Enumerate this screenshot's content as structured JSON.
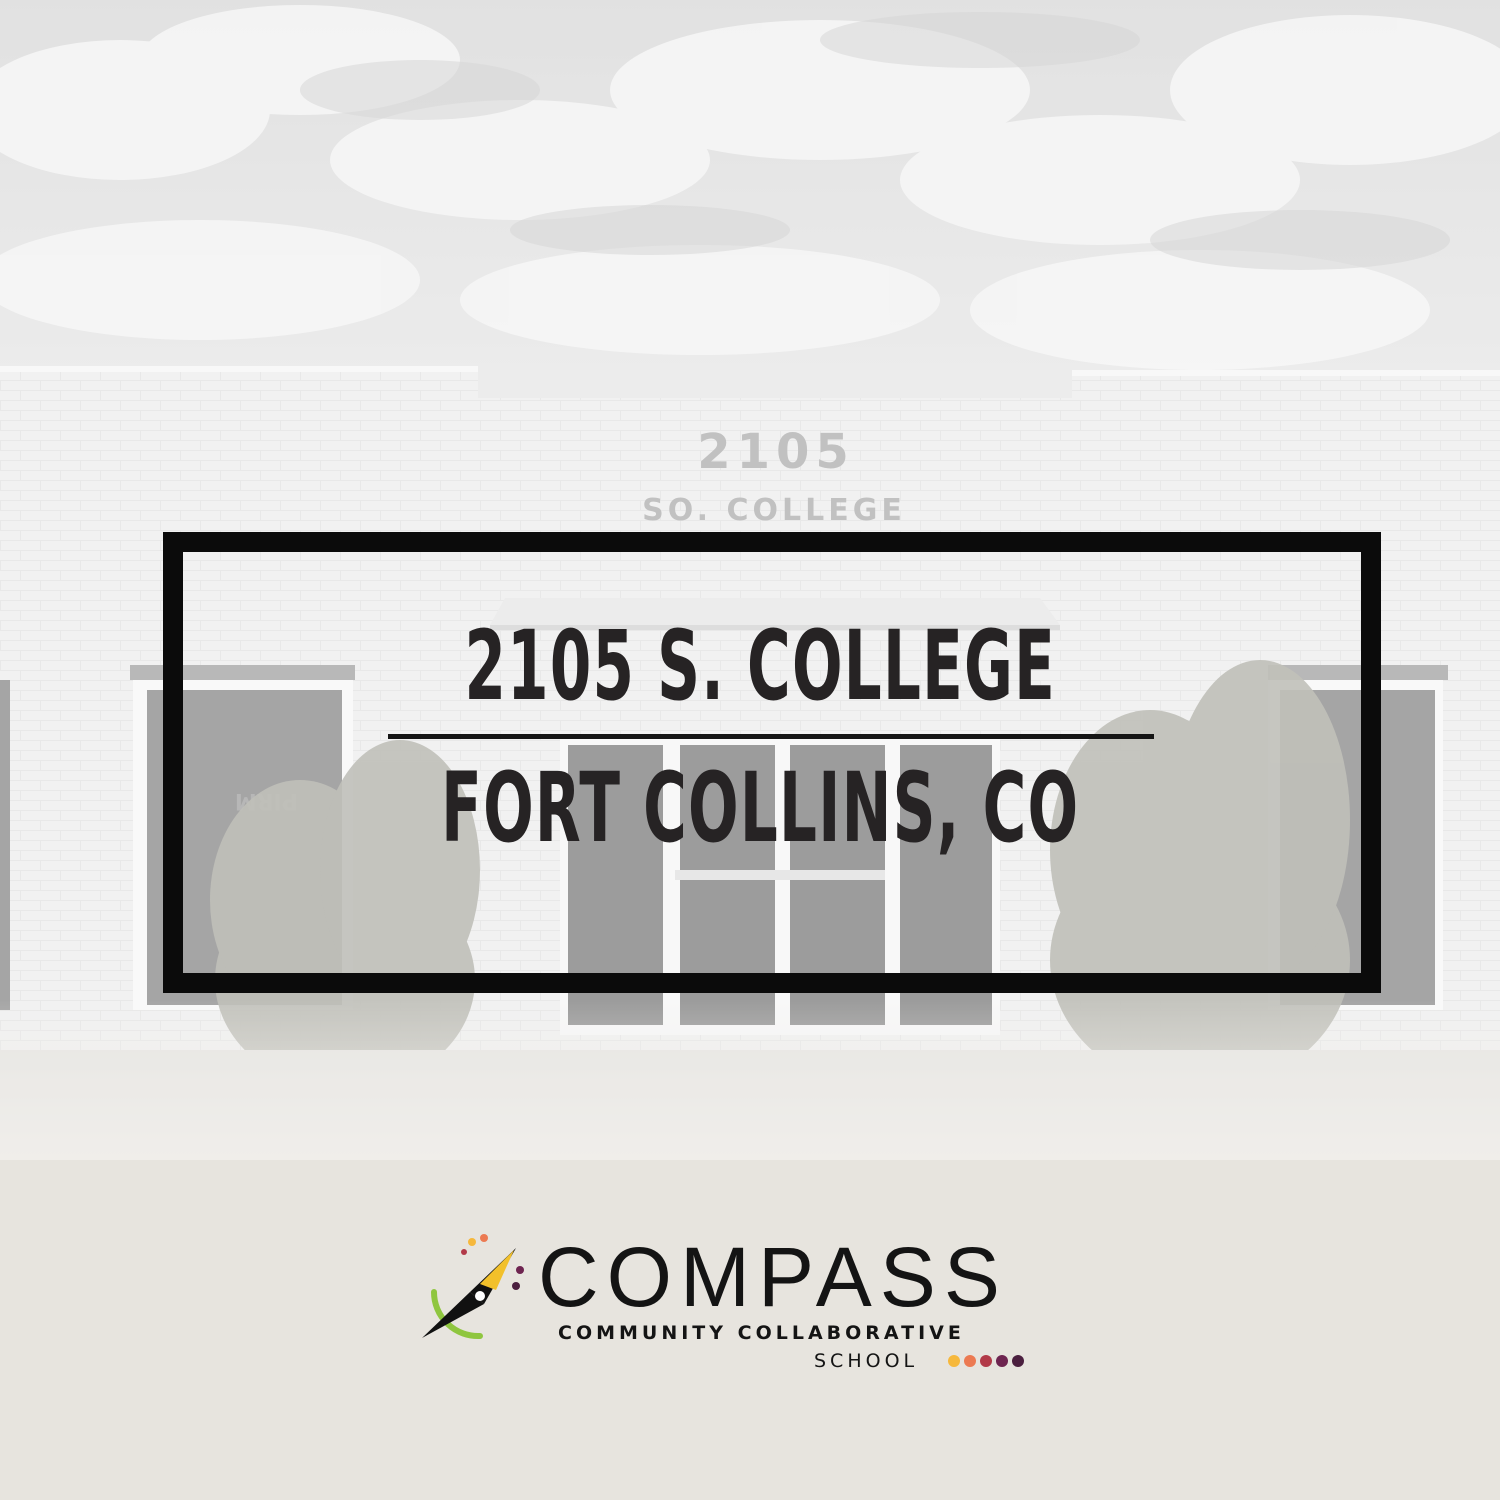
{
  "photo": {
    "facade_number": "2105",
    "facade_street": "SO. COLLEGE",
    "window_sign": "PIRM"
  },
  "overlay": {
    "address_line": "2105 S. COLLEGE",
    "city_line": "FORT COLLINS, CO"
  },
  "logo": {
    "name": "COMPASS",
    "subtitle": "COMMUNITY COLLABORATIVE",
    "school": "SCHOOL",
    "icon": "compass-needle-icon",
    "colors": {
      "needle_dark": "#111111",
      "needle_gold": "#f2c02a",
      "orbit_green": "#8fc63f",
      "dot_yellow": "#f6b83c",
      "dot_orange": "#ec7a52",
      "dot_red": "#b23a48",
      "dot_plum": "#6e2450",
      "dot_purple": "#4b1f3f"
    }
  }
}
